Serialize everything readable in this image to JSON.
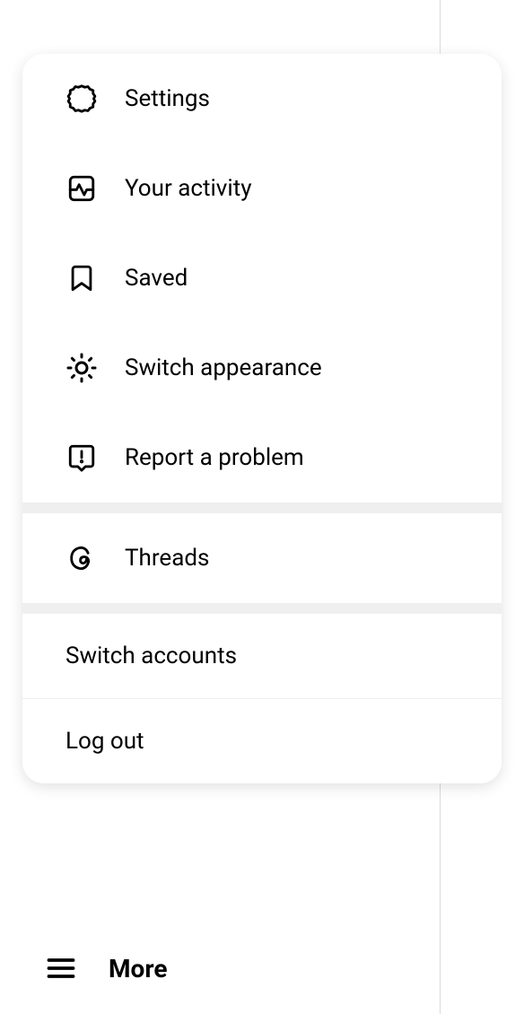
{
  "menu": {
    "sections": [
      {
        "items": [
          {
            "icon": "gear-icon",
            "label": "Settings"
          },
          {
            "icon": "activity-icon",
            "label": "Your activity"
          },
          {
            "icon": "bookmark-icon",
            "label": "Saved"
          },
          {
            "icon": "sun-icon",
            "label": "Switch appearance"
          },
          {
            "icon": "report-icon",
            "label": "Report a problem"
          }
        ]
      },
      {
        "items": [
          {
            "icon": "threads-icon",
            "label": "Threads"
          }
        ]
      },
      {
        "items": [
          {
            "icon": null,
            "label": "Switch accounts"
          },
          {
            "icon": null,
            "label": "Log out"
          }
        ]
      }
    ]
  },
  "moreButton": {
    "label": "More"
  }
}
